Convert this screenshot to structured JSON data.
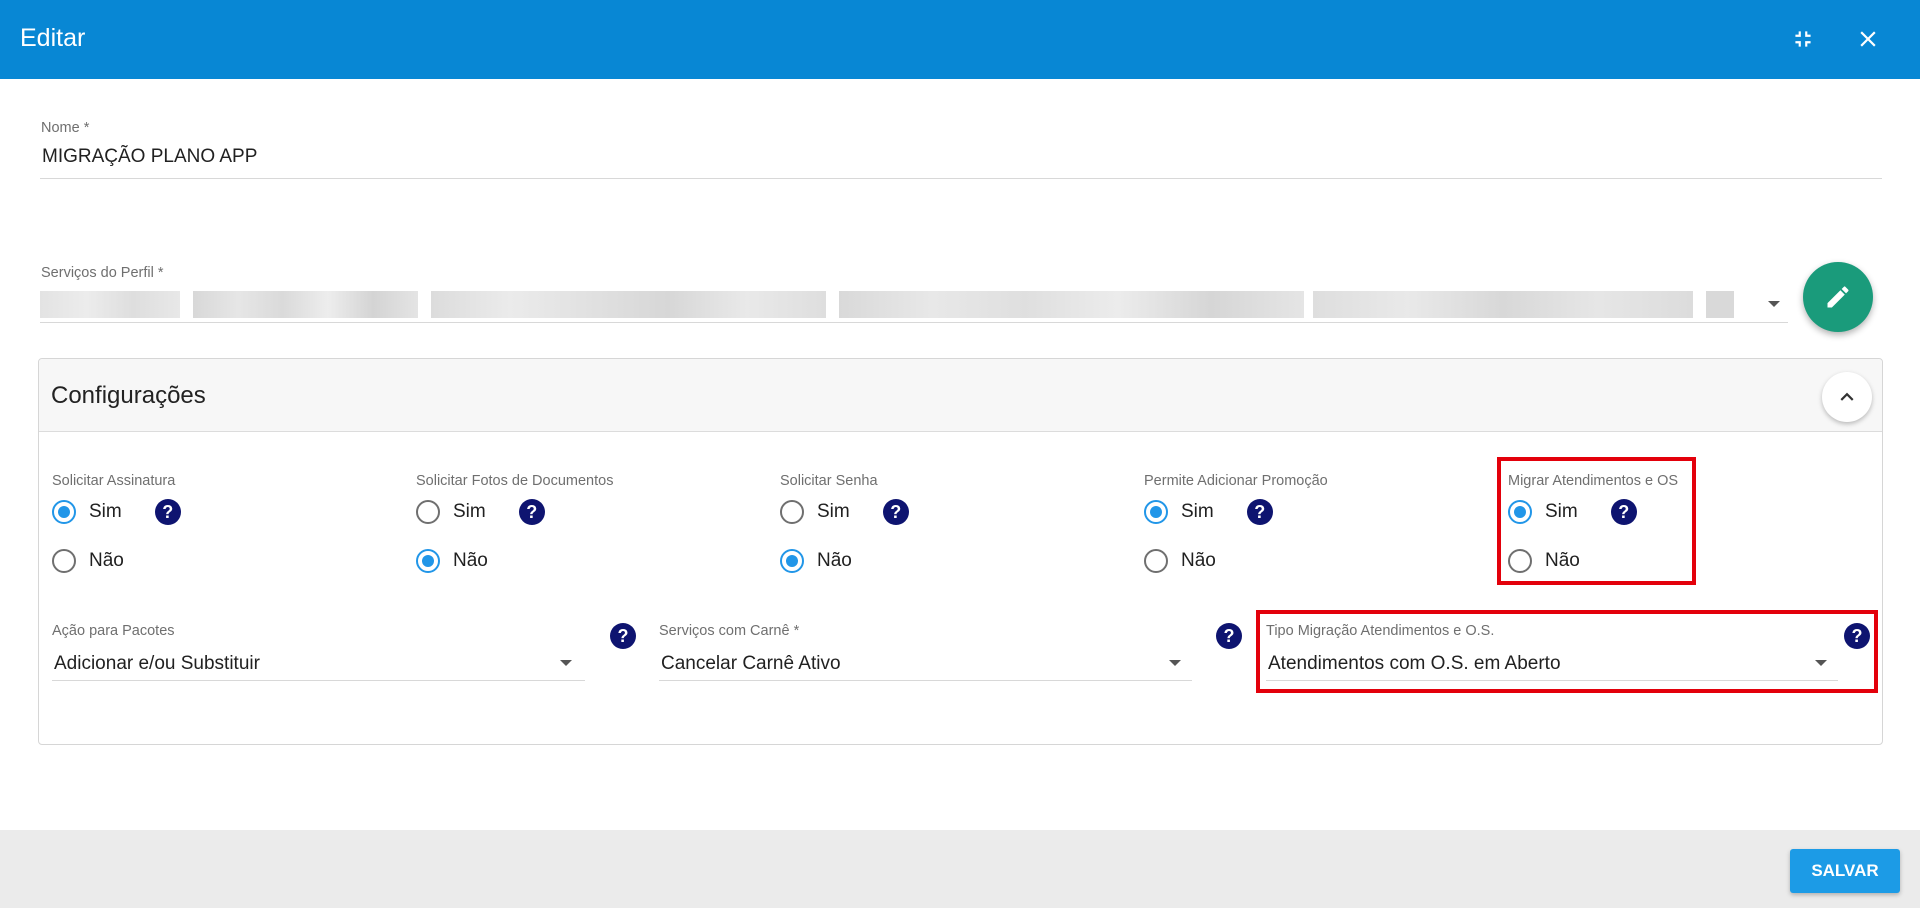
{
  "header": {
    "title": "Editar",
    "minimize_icon": "fullscreen-exit-icon",
    "close_icon": "close-icon"
  },
  "nome": {
    "label": "Nome *",
    "value": "MIGRAÇÃO PLANO APP"
  },
  "servicos_perfil": {
    "label": "Serviços do Perfil *",
    "value_redacted": true,
    "edit_icon": "pencil-icon"
  },
  "configuracoes": {
    "title": "Configurações",
    "radio_groups": [
      {
        "label": "Solicitar Assinatura",
        "options": [
          "Sim",
          "Não"
        ],
        "selected": "Sim"
      },
      {
        "label": "Solicitar Fotos de Documentos",
        "options": [
          "Sim",
          "Não"
        ],
        "selected": "Não"
      },
      {
        "label": "Solicitar Senha",
        "options": [
          "Sim",
          "Não"
        ],
        "selected": "Não"
      },
      {
        "label": "Permite Adicionar Promoção",
        "options": [
          "Sim",
          "Não"
        ],
        "selected": "Sim"
      },
      {
        "label": "Migrar Atendimentos e OS",
        "options": [
          "Sim",
          "Não"
        ],
        "selected": "Sim",
        "highlighted": true
      }
    ],
    "selects": [
      {
        "label": "Ação para Pacotes",
        "value": "Adicionar e/ou Substituir"
      },
      {
        "label": "Serviços com Carnê *",
        "value": "Cancelar Carnê Ativo"
      },
      {
        "label": "Tipo Migração Atendimentos e O.S.",
        "value": "Atendimentos com O.S. em Aberto",
        "highlighted": true
      }
    ],
    "help_symbol": "?"
  },
  "footer": {
    "save_label": "SALVAR"
  },
  "colors": {
    "header": "#0887d4",
    "accent": "#2196e8",
    "help": "#0e1470",
    "fab": "#1a9b7b",
    "highlight": "#e3000b",
    "save": "#1c9be6"
  }
}
